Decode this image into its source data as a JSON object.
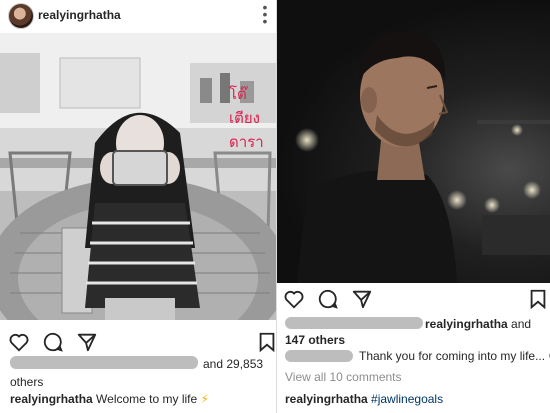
{
  "left_post": {
    "username": "realyingrhatha",
    "likes_count": "and 29,853",
    "likes_others": "others",
    "caption_user": "realyingrhatha",
    "caption_text": "Welcome to my life",
    "caption_emoji": "⚡",
    "more_icon": "vertical-dots-icon",
    "icons": [
      "heart-icon",
      "comment-icon",
      "send-icon",
      "bookmark-icon"
    ]
  },
  "right_post": {
    "liked_by_user": "realyingrhatha",
    "liked_by_and": "and",
    "likes_others": "147 others",
    "comment_text": "Thank you for coming into my life...",
    "comment_emoji": "😊",
    "view_comments": "View all 10 comments",
    "caption_user": "realyingrhatha",
    "caption_hashtag": "#jawlinegoals",
    "icons": [
      "heart-icon",
      "comment-icon",
      "send-icon",
      "bookmark-icon"
    ]
  },
  "watermark": {
    "text": "โต๊เตียงดารา",
    "color": "#d9224e"
  },
  "colors": {
    "text": "#262626",
    "link": "#003569",
    "muted": "#8e8e8e"
  }
}
